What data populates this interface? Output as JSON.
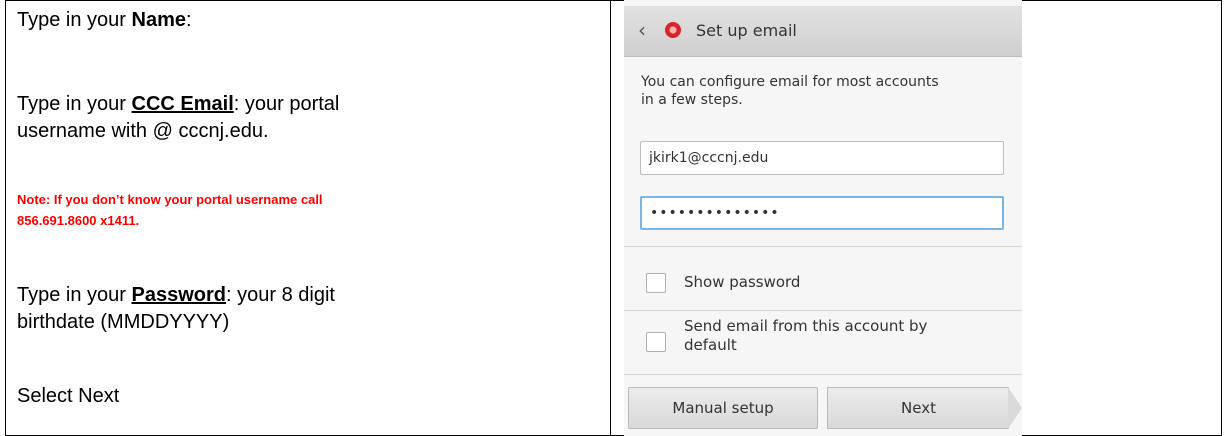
{
  "instructions": {
    "name_prefix": "Type in your ",
    "name_bold": "Name",
    "name_suffix": ":",
    "email_prefix": "Type in your ",
    "email_bold": "CCC Email",
    "email_suffix_line1": ": your portal",
    "email_line2": "username with @ cccnj.edu.",
    "note_line1": "Note: If you don’t know your portal username call",
    "note_line2": "856.691.8600 x1411.",
    "password_prefix": "Type in your ",
    "password_bold": "Password",
    "password_suffix_line1": ": your 8 digit",
    "password_line2": "birthdate (MMDDYYYY)",
    "select_next": "Select Next"
  },
  "phone": {
    "header_title": "Set up email",
    "intro_line1": "You can configure email for most accounts",
    "intro_line2": "in a few steps.",
    "email_value": "jkirk1@cccnj.edu",
    "password_value": "••••••••••••••",
    "show_password_label": "Show password",
    "send_default_line1": "Send email from this account by",
    "send_default_line2": "default",
    "manual_setup_label": "Manual setup",
    "next_label": "Next",
    "colors": {
      "note_red": "#ff0000",
      "focus_blue": "#7ab6e4",
      "app_icon_red": "#d8232a"
    }
  }
}
